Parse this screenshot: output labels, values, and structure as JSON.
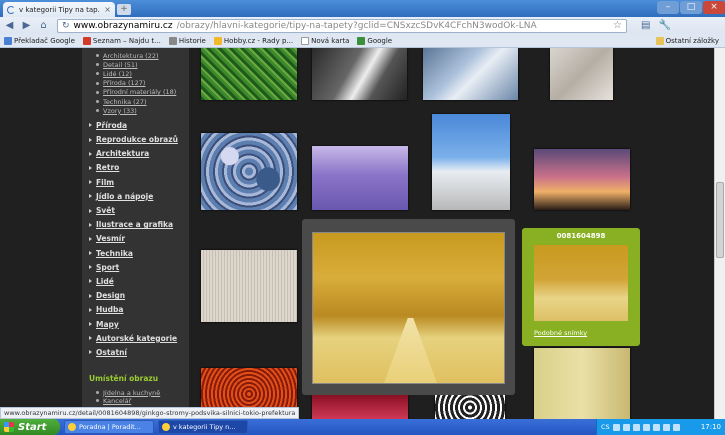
{
  "browser": {
    "tab_title": "v kategorii Tipy na tap...",
    "tab_close": "×",
    "new_tab": "+",
    "window_controls": {
      "minimize": "–",
      "maximize": "□",
      "close": "×"
    },
    "url_host": "www.obrazynamiru.cz",
    "url_path": "/obrazy/hlavni-kategorie/tipy-na-tapety?gclid=CNSxzcSDvK4CFchN3wodOk-LNA",
    "status_url": "www.obrazynamiru.cz/detail/0081604898/ginkgo-stromy-podsvika-silnici-tokio-prefektura"
  },
  "bookmarks": {
    "items": [
      {
        "label": "Překladač Google",
        "color": "#4a7fd6"
      },
      {
        "label": "Seznam – Najdu t...",
        "color": "#d23b2b"
      },
      {
        "label": "Historie",
        "color": "#888888"
      },
      {
        "label": "Hobby.cz - Rady p...",
        "color": "#f2b92a"
      },
      {
        "label": "Nová karta",
        "color": "#ffffff"
      },
      {
        "label": "Google",
        "color": "#3b8f3b"
      }
    ],
    "other": "Ostatní záložky"
  },
  "sidebar": {
    "subcategories": [
      "Architektura (22)",
      "Detail (51)",
      "Lidé (12)",
      "Příroda (127)",
      "Přírodní materiály (18)",
      "Technika (27)",
      "Vzory (33)"
    ],
    "categories": [
      "Příroda",
      "Reprodukce obrazů",
      "Architektura",
      "Retro",
      "Film",
      "Jídlo a nápoje",
      "Svět",
      "Ilustrace a grafika",
      "Vesmír",
      "Technika",
      "Sport",
      "Lidé",
      "Design",
      "Hudba",
      "Mapy",
      "Autorské kategorie",
      "Ostatní"
    ],
    "placement_title": "Umístění obrazu",
    "placement_items": [
      "Jídelna a kuchyně",
      "Kancelář"
    ]
  },
  "preview": {
    "image_id": "0081604898",
    "similar_link": "Podobné snímky"
  },
  "taskbar": {
    "start": "Start",
    "tasks": [
      "Poradna | Poradit...",
      "v kategorii Tipy n..."
    ],
    "lang": "CS",
    "clock": "17:10"
  }
}
